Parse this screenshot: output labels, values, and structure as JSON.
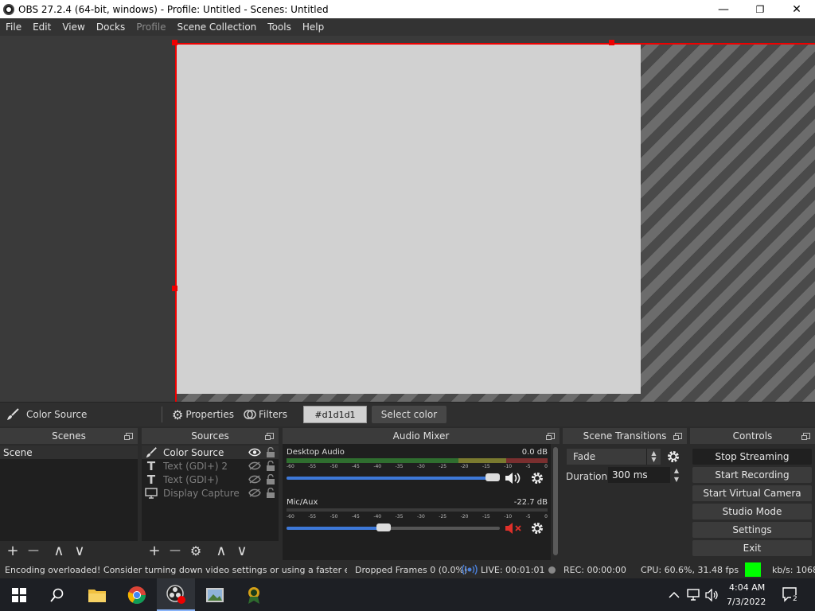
{
  "window": {
    "title": "OBS 27.2.4 (64-bit, windows) - Profile: Untitled - Scenes: Untitled",
    "minimize": "—",
    "maximize": "❐",
    "close": "✕"
  },
  "menu": [
    "File",
    "Edit",
    "View",
    "Docks",
    "Profile",
    "Scene Collection",
    "Tools",
    "Help"
  ],
  "menu_disabled": "Profile",
  "preview": {
    "source_color": "#d1d1d1",
    "selection_color": "#ee0000"
  },
  "source_toolbar": {
    "source_name": "Color Source",
    "properties": "Properties",
    "filters": "Filters",
    "color_value": "#d1d1d1",
    "select_color": "Select color"
  },
  "scenes": {
    "title": "Scenes",
    "items": [
      "Scene"
    ],
    "add": "+",
    "remove": "—",
    "up": "∧",
    "down": "∨"
  },
  "sources": {
    "title": "Sources",
    "items": [
      {
        "name": "Color Source",
        "icon": "brush-icon",
        "visible": true
      },
      {
        "name": "Text (GDI+) 2",
        "icon": "text-icon",
        "visible": false
      },
      {
        "name": "Text (GDI+)",
        "icon": "text-icon",
        "visible": false
      },
      {
        "name": "Display Capture",
        "icon": "monitor-icon",
        "visible": false
      }
    ],
    "add": "+",
    "remove": "—",
    "gear": "⚙",
    "up": "∧",
    "down": "∨"
  },
  "mixer": {
    "title": "Audio Mixer",
    "ticks": [
      "-60",
      "-55",
      "-50",
      "-45",
      "-40",
      "-35",
      "-30",
      "-25",
      "-20",
      "-15",
      "-10",
      "-5",
      "0"
    ],
    "channels": [
      {
        "name": "Desktop Audio",
        "db": "0.0 dB",
        "volume": 1.0,
        "muted": false
      },
      {
        "name": "Mic/Aux",
        "db": "-22.7 dB",
        "volume": 0.45,
        "muted": true
      }
    ]
  },
  "transitions": {
    "title": "Scene Transitions",
    "selected": "Fade",
    "duration_label": "Duration",
    "duration_value": "300 ms"
  },
  "controls": {
    "title": "Controls",
    "buttons": [
      "Stop Streaming",
      "Start Recording",
      "Start Virtual Camera",
      "Studio Mode",
      "Settings",
      "Exit"
    ]
  },
  "status": {
    "message": "Encoding overloaded! Consider turning down video settings or using a faster en",
    "dropped": "Dropped Frames 0 (0.0%)",
    "live": "LIVE: 00:01:01",
    "rec": "REC: 00:00:00",
    "cpu": "CPU: 60.6%, 31.48 fps",
    "kbs": "kb/s: 1068",
    "health_color": "#00ff00"
  },
  "taskbar": {
    "time": "4:04 AM",
    "date": "7/3/2022",
    "notifications": "2"
  }
}
